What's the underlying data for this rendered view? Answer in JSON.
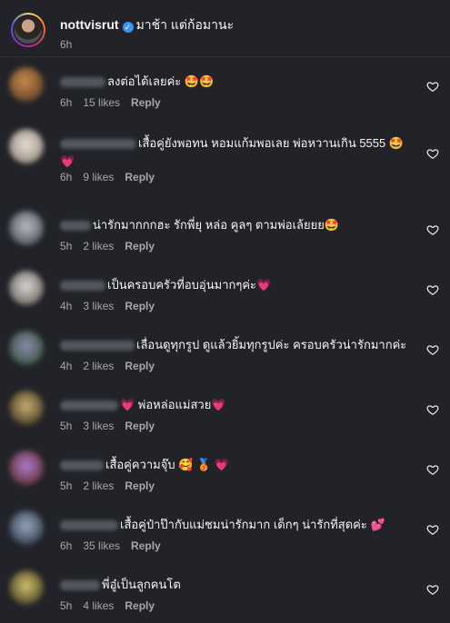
{
  "caption": {
    "username": "nottvisrut",
    "verified_icon": "check",
    "text": "มาช้า แต่ก้อมานะ",
    "time": "6h"
  },
  "comments": [
    {
      "text": "ลงต่อได้เลยค่ะ 🤩🤩",
      "time": "6h",
      "likes": "15 likes",
      "reply": "Reply"
    },
    {
      "text": "เสื้อคู่ยังพอทน หอมแก้มพอเลย พ่อหวานเกิน 5555 🤩💗",
      "time": "6h",
      "likes": "9 likes",
      "reply": "Reply"
    },
    {
      "text": "น่ารักมากกกฮะ รักพี่ยุ หล่อ คูลๆ ตามพ่อเล้ยยย🤩",
      "time": "5h",
      "likes": "2 likes",
      "reply": "Reply"
    },
    {
      "text": "เป็นครอบครัวที่อบอุ่นมากๆค่ะ💗",
      "time": "4h",
      "likes": "3 likes",
      "reply": "Reply"
    },
    {
      "text": "เลื่อนดูทุกรูป ดูแล้วยิ้มทุกรูปค่ะ ครอบครัวน่ารักมากค่ะ",
      "time": "4h",
      "likes": "2 likes",
      "reply": "Reply"
    },
    {
      "text": "💗 พ่อหล่อแม่สวย💗",
      "time": "5h",
      "likes": "3 likes",
      "reply": "Reply"
    },
    {
      "text": "เสื้อคู่ความจุ๊บ 🥰 🥉 💗",
      "time": "5h",
      "likes": "2 likes",
      "reply": "Reply"
    },
    {
      "text": "เสื้อคู่ป๋าป๊ากับแม่ชมน่ารักมาก เด็กๆ น่ารักที่สุดค่ะ 💕",
      "time": "6h",
      "likes": "35 likes",
      "reply": "Reply"
    },
    {
      "text": "พี่อู๋เป็นลูกคนโต",
      "time": "5h",
      "likes": "4 likes",
      "reply": "Reply"
    }
  ],
  "icons": {
    "like": "heart-outline-icon"
  },
  "colors": {
    "background": "#212328",
    "muted": "#a8a8a8",
    "verified": "#3897f0"
  }
}
